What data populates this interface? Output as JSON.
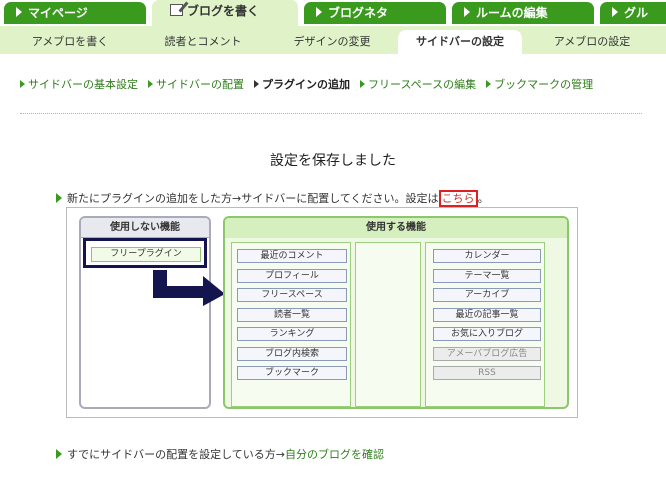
{
  "top_tabs": [
    {
      "label": "マイページ"
    },
    {
      "label": "ブログを書く"
    },
    {
      "label": "ブログネタ"
    },
    {
      "label": "ルームの編集"
    },
    {
      "label": "グル"
    }
  ],
  "sub_tabs": [
    {
      "label": "アメブロを書く"
    },
    {
      "label": "読者とコメント"
    },
    {
      "label": "デザインの変更"
    },
    {
      "label": "サイドバーの設定"
    },
    {
      "label": "アメブロの設定"
    }
  ],
  "nav_items": [
    {
      "label": "サイドバーの基本設定"
    },
    {
      "label": "サイドバーの配置"
    },
    {
      "label": "プラグインの追加"
    },
    {
      "label": "フリースペースの編集"
    },
    {
      "label": "ブックマークの管理"
    }
  ],
  "saved_message": "設定を保存しました",
  "message1": {
    "text": "新たにプラグインの追加をした方→サイドバーに配置してください。設定は",
    "link": "こちら",
    "suffix": "。"
  },
  "illustration": {
    "unused_title": "使用しない機能",
    "used_title": "使用する機能",
    "unused_items": [
      "フリープラグイン"
    ],
    "left_items": [
      "最近のコメント",
      "プロフィール",
      "フリースペース",
      "読者一覧",
      "ランキング",
      "ブログ内検索",
      "ブックマーク"
    ],
    "right_items": [
      "カレンダー",
      "テーマ一覧",
      "アーカイブ",
      "最近の記事一覧",
      "お気に入りブログ",
      "アメーバブログ広告",
      "RSS"
    ],
    "right_disabled_indices": [
      5,
      6
    ]
  },
  "message2": {
    "text": "すでにサイドバーの配置を設定している方→",
    "link": "自分のブログを確認"
  },
  "colors": {
    "tab_green": "#3a9a1e",
    "light_green": "#dff2c8",
    "highlight_navy": "#14154f",
    "link_red": "#e02020"
  }
}
